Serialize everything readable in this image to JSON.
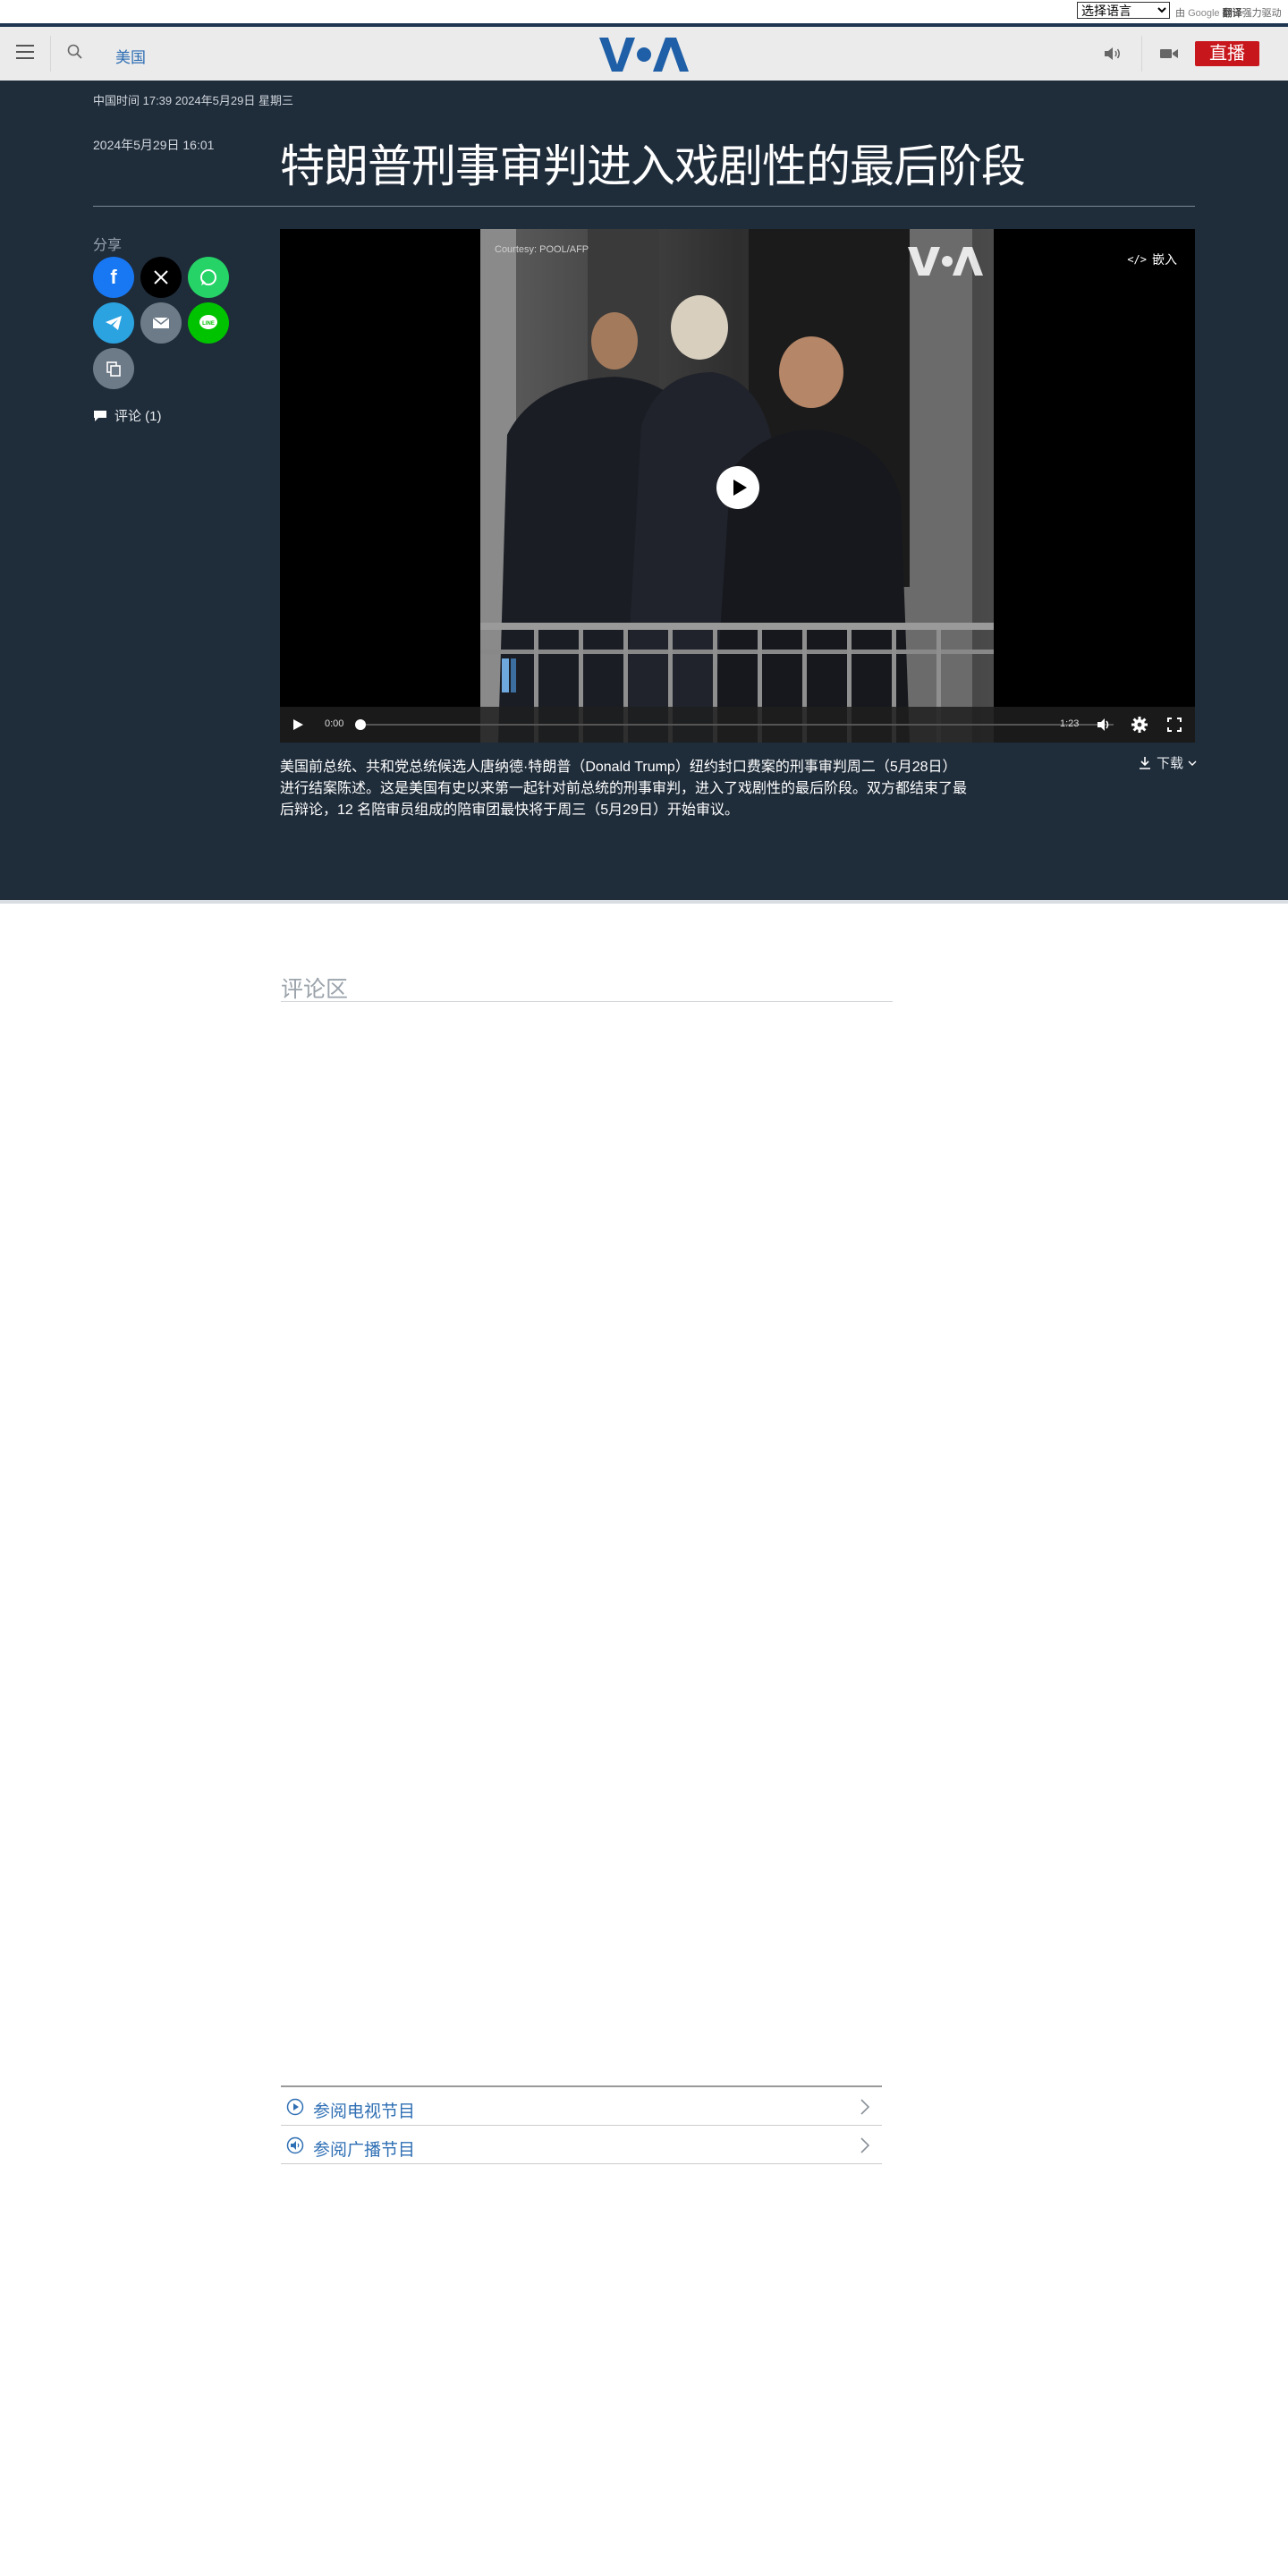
{
  "translate_bar": {
    "select_value": "选择语言",
    "powered_prefix": "由",
    "powered_brand": "Google",
    "powered_word": "翻译",
    "powered_suffix": "强力驱动"
  },
  "nav": {
    "section": "美国",
    "live_label": "直播",
    "logo_text": "VOA",
    "icons": [
      "menu-icon",
      "search-icon",
      "audio-icon",
      "video-icon"
    ]
  },
  "article": {
    "timezone_line": "中国时间 17:39 2024年5月29日 星期三",
    "published": "2024年5月29日 16:01",
    "title": "特朗普刑事审判进入戏剧性的最后阶段",
    "caption": "美国前总统、共和党总统候选人唐纳德·特朗普（Donald Trump）纽约封口费案的刑事审判周二（5月28日）进行结案陈述。这是美国有史以来第一起针对前总统的刑事审判，进入了戏剧性的最后阶段。双方都结束了最后辩论，12 名陪审员组成的陪审团最快将于周三（5月29日）开始审议。"
  },
  "share": {
    "label": "分享",
    "buttons": [
      {
        "name": "facebook",
        "glyph": "f",
        "color": "#1877f2"
      },
      {
        "name": "x",
        "glyph": "𝕏",
        "color": "#000000"
      },
      {
        "name": "whatsapp",
        "glyph": "✆",
        "color": "#25d366"
      },
      {
        "name": "telegram",
        "glyph": "➤",
        "color": "#2aa3e0"
      },
      {
        "name": "email",
        "glyph": "✉",
        "color": "#6d7a87"
      },
      {
        "name": "line",
        "glyph": "LINE",
        "color": "#00c300"
      },
      {
        "name": "copy",
        "glyph": "⧉",
        "color": "#6d7a87"
      }
    ],
    "comments_link": "评论 (1)"
  },
  "player": {
    "embed_label": "嵌入",
    "credit": "Courtesy: POOL/AFP",
    "current_time": "0:00",
    "duration": "1:23",
    "progress": 0,
    "download_label": "下载"
  },
  "comments": {
    "title": "评论区"
  },
  "program_links": [
    {
      "label": "参阅电视节目",
      "icon": "play-circle-icon"
    },
    {
      "label": "参阅广播节目",
      "icon": "audio-circle-icon"
    }
  ]
}
